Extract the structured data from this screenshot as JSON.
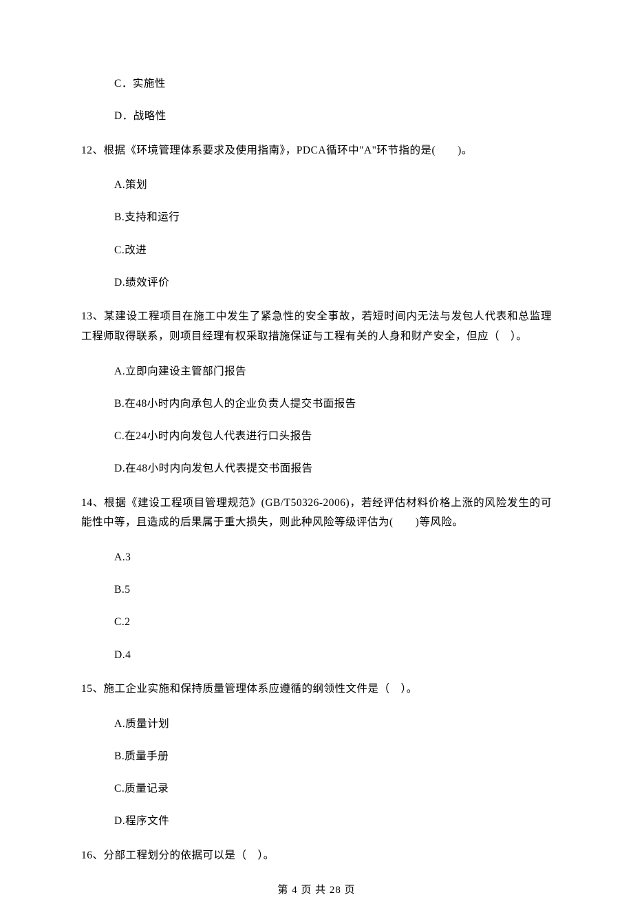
{
  "leading_options": {
    "c": "C．实施性",
    "d": "D．战略性"
  },
  "q12": {
    "stem": "12、根据《环境管理体系要求及使用指南》，PDCA循环中\"A\"环节指的是(　　)。",
    "a": "A.策划",
    "b": "B.支持和运行",
    "c": "C.改进",
    "d": "D.绩效评价"
  },
  "q13": {
    "stem": "13、某建设工程项目在施工中发生了紧急性的安全事故，若短时间内无法与发包人代表和总监理工程师取得联系，则项目经理有权采取措施保证与工程有关的人身和财产安全，但应（　）。",
    "a": "A.立即向建设主管部门报告",
    "b": "B.在48小时内向承包人的企业负责人提交书面报告",
    "c": "C.在24小时内向发包人代表进行口头报告",
    "d": "D.在48小时内向发包人代表提交书面报告"
  },
  "q14": {
    "stem": "14、根据《建设工程项目管理规范》(GB/T50326-2006)，若经评估材料价格上涨的风险发生的可能性中等，且造成的后果属于重大损失，则此种风险等级评估为(　　)等风险。",
    "a": "A.3",
    "b": "B.5",
    "c": "C.2",
    "d": "D.4"
  },
  "q15": {
    "stem": "15、施工企业实施和保持质量管理体系应遵循的纲领性文件是（　）。",
    "a": "A.质量计划",
    "b": "B.质量手册",
    "c": "C.质量记录",
    "d": "D.程序文件"
  },
  "q16": {
    "stem": "16、分部工程划分的依据可以是（　）。"
  },
  "footer": "第 4 页 共 28 页"
}
